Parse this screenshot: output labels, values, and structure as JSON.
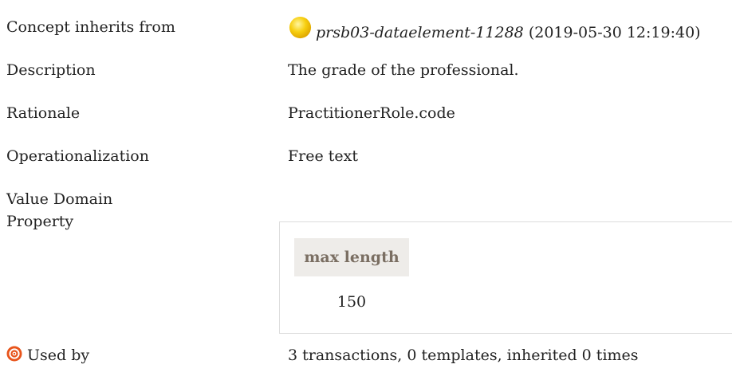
{
  "concept": {
    "inherits_label": "Concept inherits from",
    "inherits_link": "prsb03-dataelement-11288",
    "inherits_timestamp": "(2019-05-30 12:19:40)",
    "status_color": "#f5c400"
  },
  "description": {
    "label": "Description",
    "value": "The grade of the professional."
  },
  "rationale": {
    "label": "Rationale",
    "value": "PractitionerRole.code"
  },
  "operationalization": {
    "label": "Operationalization",
    "value": "Free text"
  },
  "value_domain": {
    "label": "Value Domain"
  },
  "property": {
    "label": "Property",
    "column_header": "max length",
    "column_value": "150"
  },
  "used_by": {
    "label": "Used by",
    "value": "3 transactions, 0 templates, inherited 0 times",
    "icon": "target-icon",
    "icon_color": "#e8541b"
  }
}
